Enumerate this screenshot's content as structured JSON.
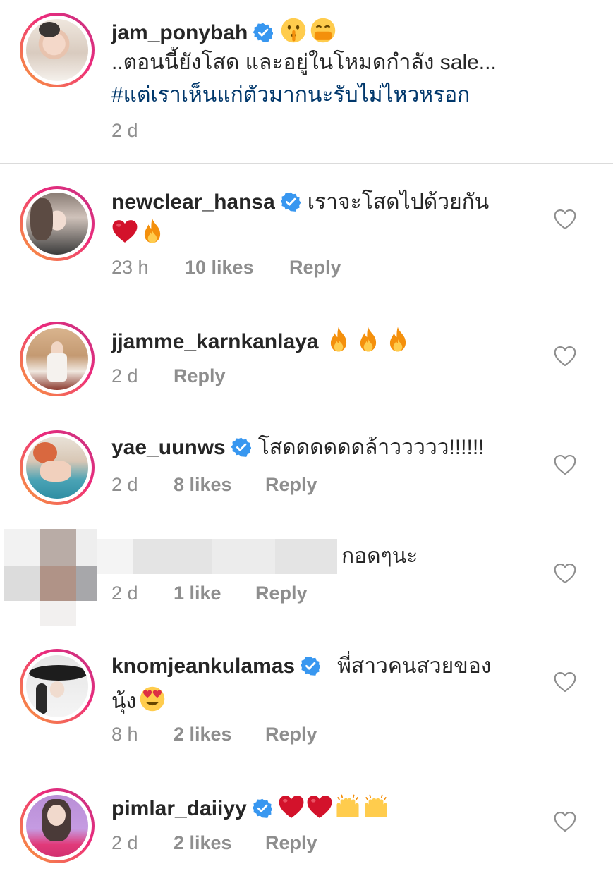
{
  "caption": {
    "username": "jam_ponybah",
    "verified": true,
    "emoji_icons": [
      "shushing-face-icon",
      "hand-over-mouth-face-icon"
    ],
    "text": "..ตอนนี้ยังโสด และอยู่ในโหมดกำลัง sale...",
    "hashtag": "#แต่เราเห็นแก่ตัวมากนะรับไม่ไหวหรอก",
    "time": "2 d"
  },
  "comments": [
    {
      "username": "newclear_hansa",
      "verified": true,
      "text": "เราจะโสดไปด้วยกัน",
      "emoji_icons": [
        "red-heart-icon",
        "fire-icon"
      ],
      "time": "23 h",
      "likes": "10 likes",
      "reply": "Reply"
    },
    {
      "username": "jjamme_karnkanlaya",
      "verified": false,
      "text": "",
      "emoji_icons": [
        "fire-icon",
        "fire-icon",
        "fire-icon"
      ],
      "time": "2 d",
      "likes": "",
      "reply": "Reply"
    },
    {
      "username": "yae_uunws",
      "verified": true,
      "text": "โสดดดดดดล้าววววว!!!!!!",
      "emoji_icons": [],
      "time": "2 d",
      "likes": "8 likes",
      "reply": "Reply"
    },
    {
      "username": "",
      "verified": false,
      "text": "กอดๆนะ",
      "emoji_icons": [],
      "time": "2 d",
      "likes": "1 like",
      "reply": "Reply",
      "redacted": true
    },
    {
      "username": "knomjeankulamas",
      "verified": true,
      "text": "พี่สาวคนสวยของ",
      "text2": "นุ้ง",
      "emoji_icons": [
        "heart-eyes-face-icon"
      ],
      "time": "8 h",
      "likes": "2 likes",
      "reply": "Reply"
    },
    {
      "username": "pimlar_daiiyy",
      "verified": true,
      "text": "",
      "emoji_icons": [
        "red-heart-icon",
        "red-heart-icon",
        "raising-hands-icon",
        "raising-hands-icon"
      ],
      "time": "2 d",
      "likes": "2 likes",
      "reply": "Reply"
    }
  ],
  "colors": {
    "text": "#262626",
    "secondary": "#8e8e8e",
    "hashtag": "#00376b",
    "verified": "#3897f0",
    "divider": "#dbdbdb"
  }
}
